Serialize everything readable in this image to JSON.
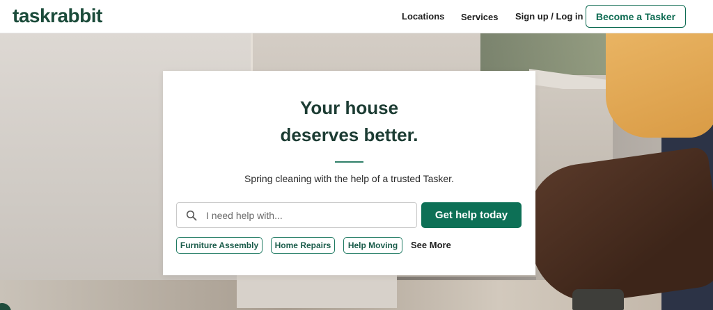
{
  "header": {
    "logo": "taskrabbit",
    "nav": {
      "locations": "Locations",
      "services": "Services",
      "signup": "Sign up / Log in"
    },
    "cta": "Become a Tasker"
  },
  "hero": {
    "headline_line1": "Your house",
    "headline_line2": "deserves better.",
    "subtitle": "Spring cleaning with the help of a trusted Tasker.",
    "search": {
      "placeholder": "I need help with...",
      "value": ""
    },
    "cta": "Get help today",
    "chips": [
      {
        "label": "Furniture Assembly"
      },
      {
        "label": "Home Repairs"
      },
      {
        "label": "Help Moving"
      }
    ],
    "see_more": "See More"
  },
  "colors": {
    "brand_green": "#0d7056",
    "brand_dark": "#1b4b3a",
    "text": "#1f1f1f"
  },
  "icons": {
    "search": "search-icon"
  }
}
